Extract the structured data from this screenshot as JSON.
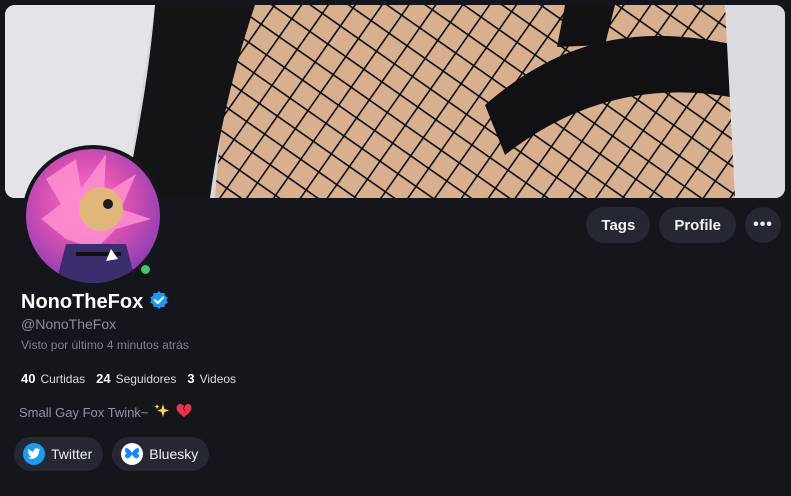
{
  "profile": {
    "display_name": "NonoTheFox",
    "handle": "@NonoTheFox",
    "last_seen": "Visto por último 4 minutos atrás",
    "verified": true,
    "online": true,
    "bio": "Small Gay Fox Twink~",
    "bio_emojis": [
      "sparkles-icon",
      "broken-heart-icon"
    ]
  },
  "stats": [
    {
      "value": "40",
      "label": "Curtidas"
    },
    {
      "value": "24",
      "label": "Seguidores"
    },
    {
      "value": "3",
      "label": "Videos"
    }
  ],
  "actions": {
    "tags_label": "Tags",
    "profile_label": "Profile",
    "more_label": "•••"
  },
  "socials": [
    {
      "label": "Twitter",
      "icon": "twitter-icon"
    },
    {
      "label": "Bluesky",
      "icon": "butterfly-icon"
    }
  ],
  "colors": {
    "background": "#15161b",
    "button": "#252833",
    "verified": "#1d9bf0",
    "online": "#46c26a"
  }
}
